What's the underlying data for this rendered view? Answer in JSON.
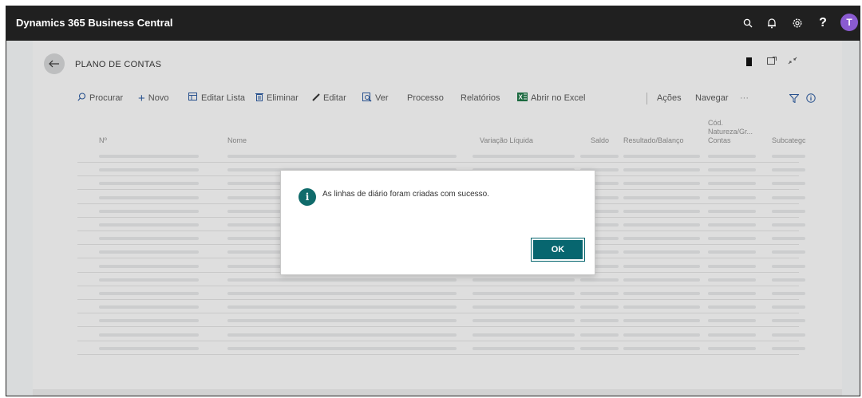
{
  "app": {
    "title": "Dynamics 365 Business Central",
    "user_initial": "T"
  },
  "header_icons": [
    "search-icon",
    "bell-icon",
    "gear-icon",
    "help-icon"
  ],
  "header_glyphs": {
    "search": "⌕",
    "bell": "🔔",
    "gear": "⚙",
    "help": "?"
  },
  "page": {
    "title": "PLANO DE CONTAS"
  },
  "toolbar": {
    "search_label": "Procurar",
    "new_label": "Novo",
    "edit_list_label": "Editar Lista",
    "delete_label": "Eliminar",
    "edit_label": "Editar",
    "view_label": "Ver",
    "process_label": "Processo",
    "reports_label": "Relatórios",
    "excel_label": "Abrir no Excel",
    "actions_label": "Ações",
    "navigate_label": "Navegar",
    "more_label": "···"
  },
  "table": {
    "columns": {
      "no": "Nº",
      "name": "Nome",
      "net_change": "Variação Líquida",
      "balance": "Saldo",
      "income_balance": "Resultado/Balanço",
      "nature_code_1": "Cód.",
      "nature_code_2": "Natureza/Gr...",
      "nature_code_3": "Contas",
      "subcategory": "Subcatego"
    }
  },
  "dialog": {
    "message": "As linhas de diário foram criadas com sucesso.",
    "ok_label": "OK",
    "info_glyph": "i"
  },
  "colors": {
    "topbar": "#202020",
    "accent": "#07666f",
    "avatar": "#8a5bd1"
  }
}
